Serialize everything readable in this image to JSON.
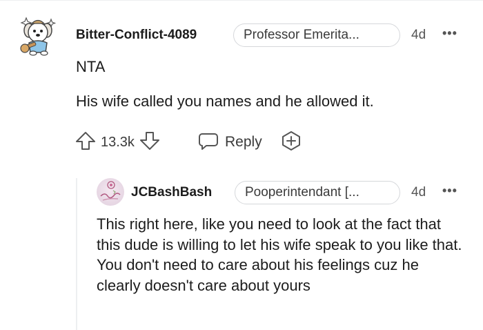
{
  "comment": {
    "username": "Bitter-Conflict-4089",
    "flair": "Professor Emerita...",
    "time": "4d",
    "more": "•••",
    "body_line1": "NTA",
    "body_line2": "His wife called you names and he allowed it.",
    "actions": {
      "upvote_icon": "upvote-arrow-icon",
      "vote_count": "13.3k",
      "downvote_icon": "downvote-arrow-icon",
      "reply_icon": "speech-bubble-icon",
      "reply_label": "Reply",
      "award_icon": "award-plus-icon"
    }
  },
  "reply": {
    "username": "JCBashBash",
    "flair": "Pooperintendant [...",
    "time": "4d",
    "more": "•••",
    "body": "This right here, like you need to look at the fact that this dude is willing to let his wife speak to you like that. You don't need to care about his feelings cuz he clearly doesn't care about yours"
  },
  "colors": {
    "text": "#1c1c1c",
    "meta": "#555555",
    "flair_border": "#d5d7da",
    "thread_line": "#edeff1"
  }
}
